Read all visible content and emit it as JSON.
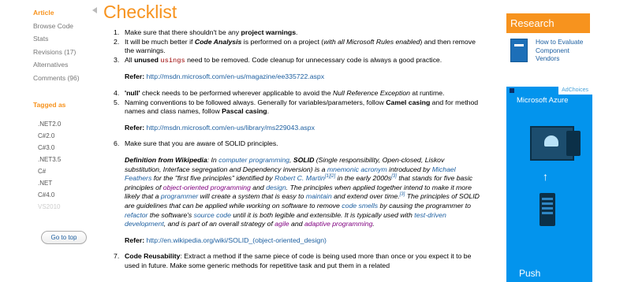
{
  "sidebar": {
    "items": [
      {
        "label": "Article"
      },
      {
        "label": "Browse Code"
      },
      {
        "label": "Stats"
      },
      {
        "label": "Revisions (17)"
      },
      {
        "label": "Alternatives"
      },
      {
        "label": "Comments (96)"
      }
    ],
    "tagged_as": "Tagged as",
    "tags": [
      ".NET2.0",
      "C#2.0",
      "C#3.0",
      ".NET3.5",
      "C#",
      ".NET",
      "C#4.0",
      "VS2010"
    ],
    "goto_top": "Go to top"
  },
  "main": {
    "title": "Checklist",
    "items": [
      {
        "number": "1.",
        "pre": "Make sure that there shouldn't be any ",
        "bold": "project warnings",
        "post": "."
      },
      {
        "number": "2.",
        "pre": "It will be much better if ",
        "bold_italic": "Code Analysis",
        "mid": " is performed on a project (",
        "italic": "with all Microsoft Rules enabled",
        "post": ") and then remove the warnings."
      },
      {
        "number": "3.",
        "pre": "All ",
        "bold": "unused",
        "code": "usings",
        "post": " need to be removed. Code cleanup for unnecessary code is always a good practice."
      },
      {
        "number": "4.",
        "bold": "'null'",
        "pre": " check needs to be performed wherever applicable to avoid the ",
        "italic": "Null Reference Exception",
        "post": " at runtime."
      },
      {
        "number": "5.",
        "pre": "Naming conventions to be followed always. Generally for variables/parameters, follow ",
        "bold": "Camel casing",
        "mid": " and for method names and class names, follow ",
        "bold2": "Pascal casing",
        "post": "."
      },
      {
        "number": "6.",
        "text": "Make sure that you are aware of SOLID principles."
      },
      {
        "number": "7.",
        "bold": "Code Reusability",
        "post": ": Extract a method if the same piece of code is being used more than once or you expect it to be used in future. Make some generic methods for repetitive task and put them in a related"
      }
    ],
    "refer_label": "Refer:",
    "ref1": "http://msdn.microsoft.com/en-us/magazine/ee335722.aspx",
    "ref2": "http://msdn.microsoft.com/en-us/library/ms229043.aspx",
    "ref3": "http://en.wikipedia.org/wiki/SOLID_(object-oriented_design)",
    "definition": {
      "lead": "Definition from Wikipedia",
      "t1": ": In ",
      "l_cp": "computer programming",
      "t2": ", ",
      "solid": "SOLID",
      "t3": " (Single responsibility, Open-closed, Liskov substitution, Interface segregation and Dependency inversion) is a ",
      "l_mnemonic": "mnemonic acronym",
      "t4": " introduced by ",
      "l_feathers": "Michael Feathers",
      "t5": " for the \"first five principles\" identified by ",
      "l_martin": "Robert C. Martin",
      "sup12": "[1][2]",
      "t6": " in the early 2000s",
      "sup3": "[3]",
      "t7": " that stands for five basic principles of ",
      "l_oop": "object-oriented programming",
      "t8": " and ",
      "l_design": "design",
      "t9": ". The principles when applied together intend to make it more likely that a ",
      "l_programmer": "programmer",
      "t10": " will create a system that is easy to ",
      "l_maintain": "maintain",
      "t11": " and extend over time.",
      "sup3b": "[3]",
      "t12": " The principles of SOLID are guidelines that can be applied while working on software to remove ",
      "l_smells": "code smells",
      "t13": " by causing the programmer to ",
      "l_refactor": "refactor",
      "t14": " the software's ",
      "l_source": "source code",
      "t15": " until it is both legible and extensible. It is typically used with ",
      "l_tdd": "test-driven development",
      "t16": ", and is part of an overall strategy of ",
      "l_agile": "agile",
      "t17": " and ",
      "l_adaptive": "adaptive programming",
      "t18": "."
    }
  },
  "right": {
    "research_title": "Research",
    "research_link": "How to Evaluate Component Vendors",
    "ad": {
      "choices": "AdChoices",
      "brand": "Microsoft Azure",
      "push": "Push"
    }
  },
  "colors": {
    "accent": "#f7931e",
    "link": "#1d5fa0",
    "ad_bg": "#0394ed"
  }
}
